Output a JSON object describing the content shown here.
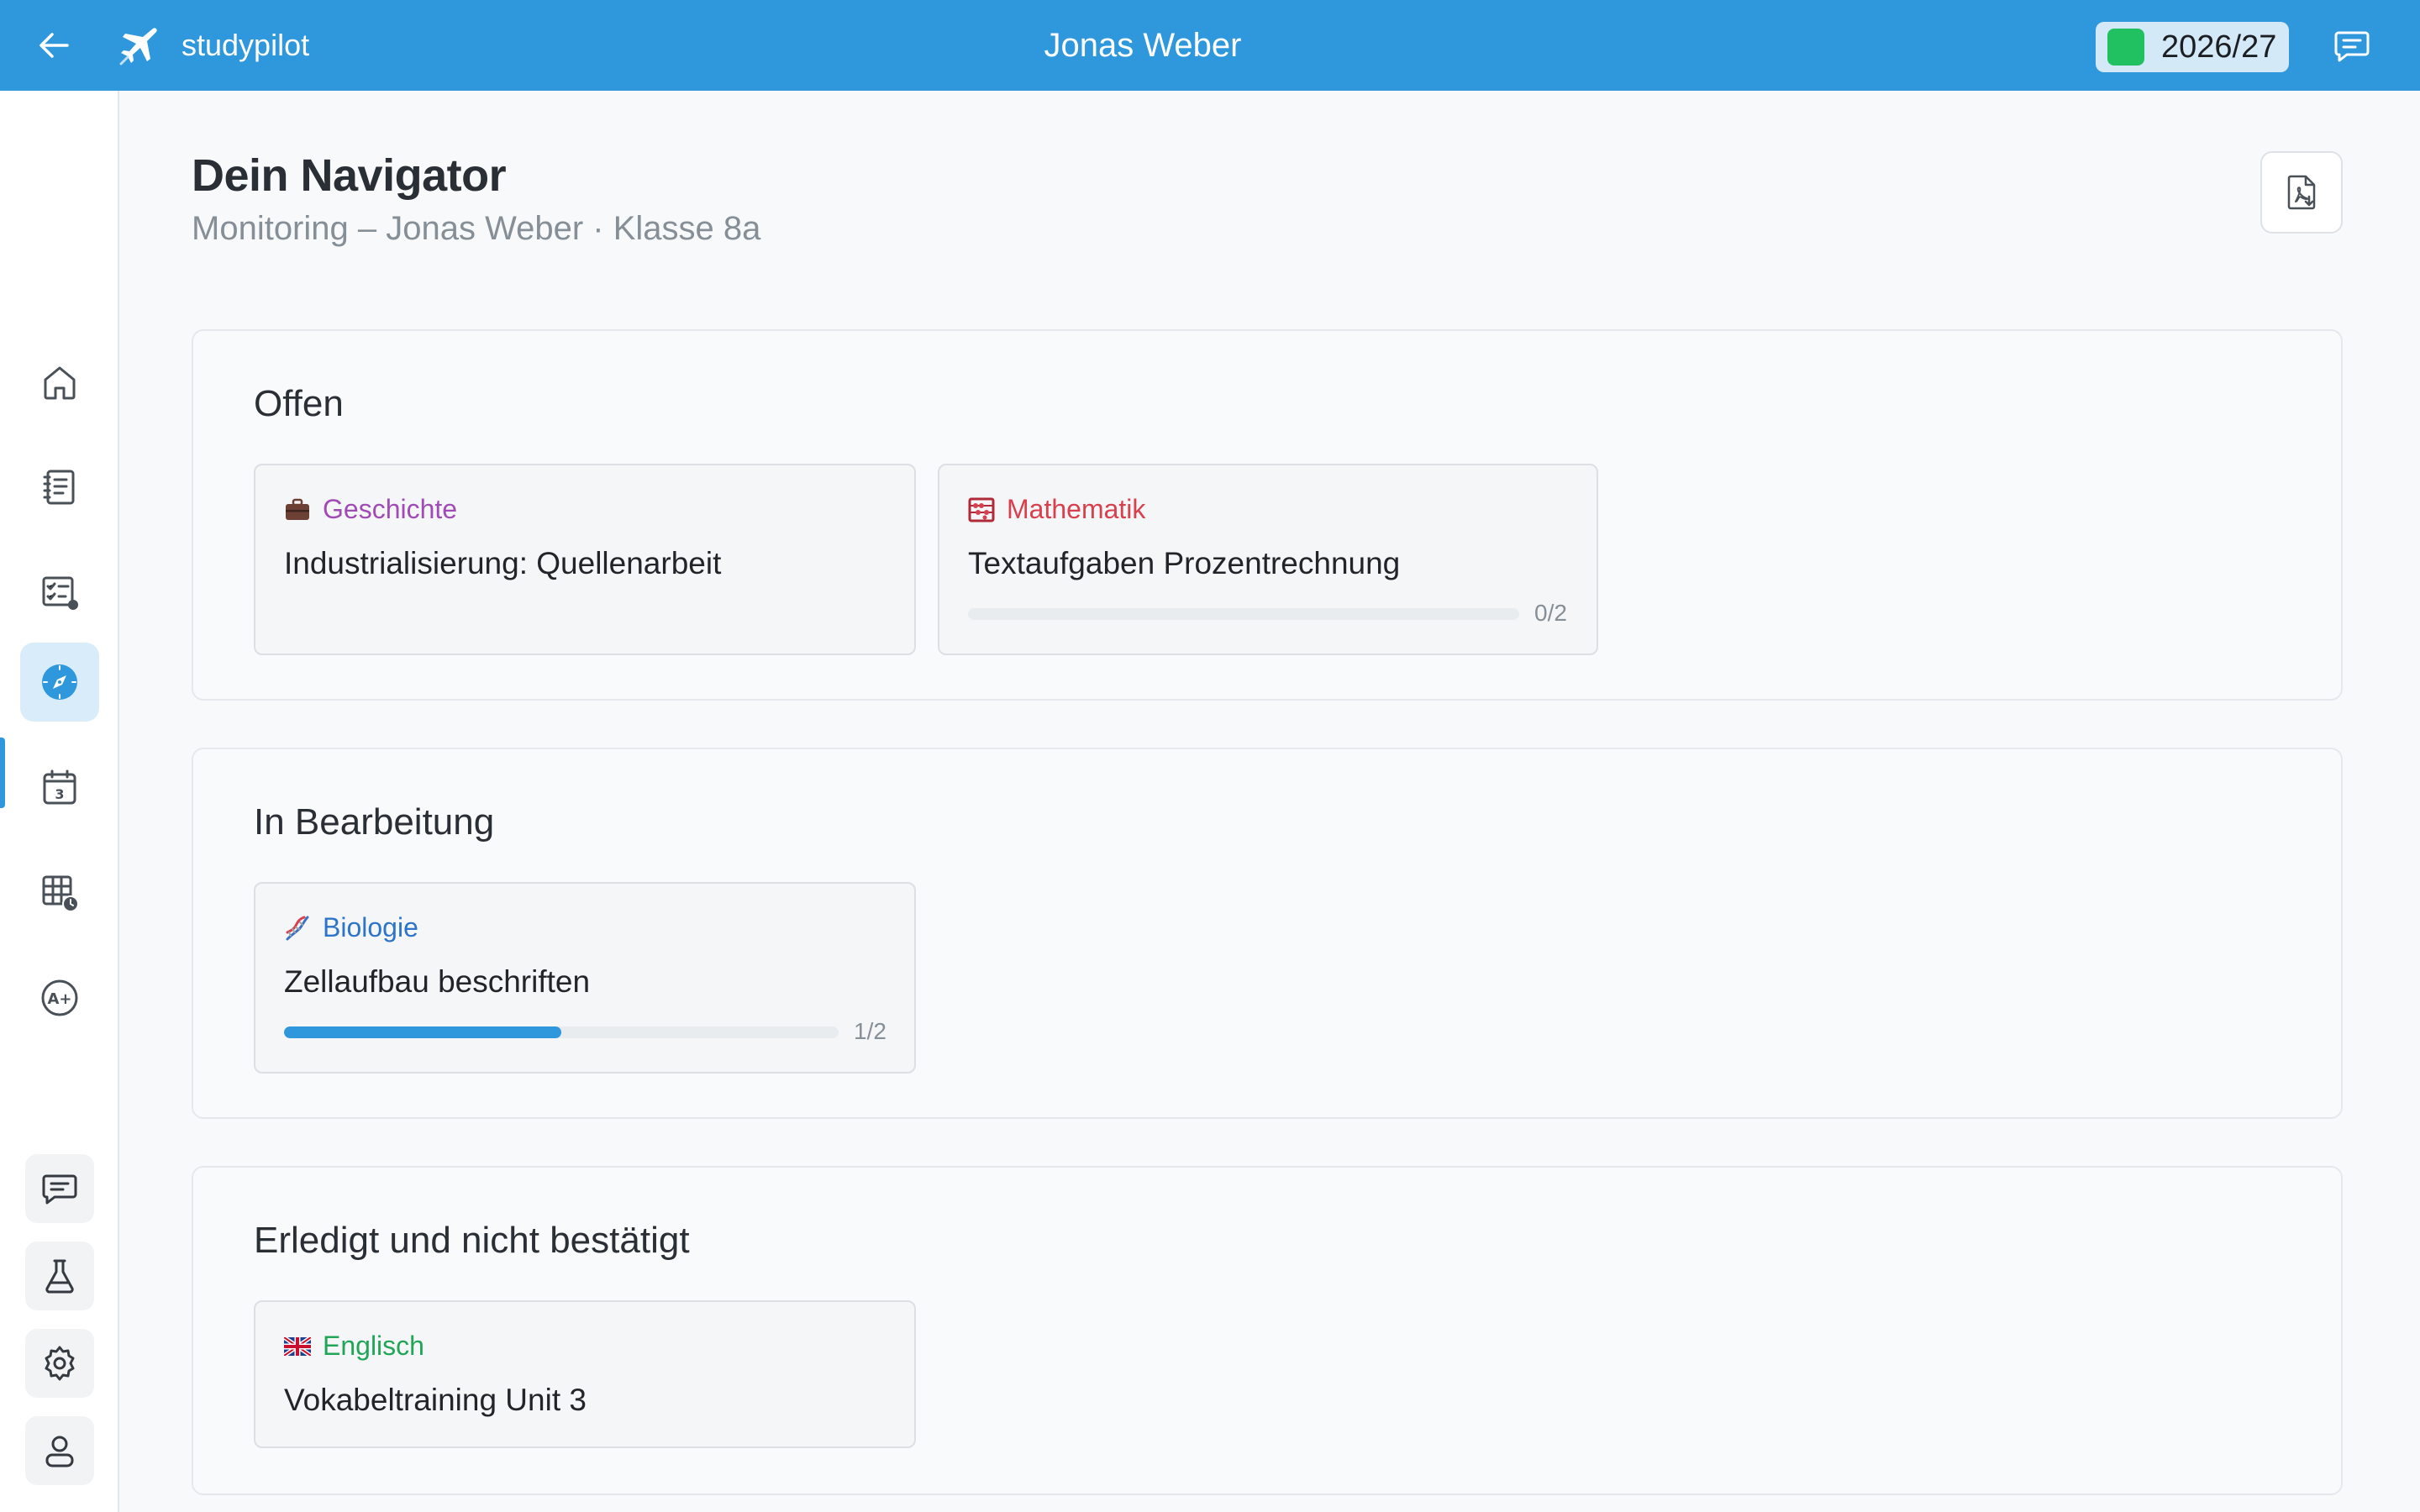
{
  "app": {
    "name": "studypilot"
  },
  "header": {
    "user_name": "Jonas Weber",
    "school_year": "2026/27",
    "year_color": "#21c161",
    "accent_color": "#2f97db"
  },
  "sidebar": {
    "items": [
      {
        "icon": "home-icon"
      },
      {
        "icon": "notebook-icon"
      },
      {
        "icon": "checklist-icon"
      },
      {
        "icon": "compass-icon",
        "active": true
      },
      {
        "icon": "calendar-icon",
        "text": "3"
      },
      {
        "icon": "timetable-icon"
      },
      {
        "icon": "grade-icon",
        "text": "A+"
      }
    ],
    "bottom": [
      {
        "icon": "chat-icon"
      },
      {
        "icon": "flask-icon"
      },
      {
        "icon": "settings-icon"
      },
      {
        "icon": "profile-icon"
      }
    ]
  },
  "page": {
    "title": "Dein Navigator",
    "subtitle": "Monitoring – Jonas Weber · Klasse 8a"
  },
  "sections": [
    {
      "title": "Offen",
      "tasks": [
        {
          "subject": "Geschichte",
          "subject_color": "#a04cb5",
          "icon": "briefcase-icon",
          "title": "Industrialisierung: Quellenarbeit"
        },
        {
          "subject": "Mathematik",
          "subject_color": "#d9404d",
          "icon": "abacus-icon",
          "title": "Textaufgaben Prozentrechnung",
          "progress_label": "0/2",
          "progress": 0.0
        }
      ]
    },
    {
      "title": "In Bearbeitung",
      "tasks": [
        {
          "subject": "Biologie",
          "subject_color": "#2e74c9",
          "icon": "dna-icon",
          "title": "Zellaufbau beschriften",
          "progress_label": "1/2",
          "progress": 0.5
        }
      ]
    },
    {
      "title": "Erledigt und nicht bestätigt",
      "tasks": [
        {
          "subject": "Englisch",
          "subject_color": "#22a558",
          "icon": "uk-flag-icon",
          "title": "Vokabeltraining Unit 3"
        }
      ]
    }
  ]
}
